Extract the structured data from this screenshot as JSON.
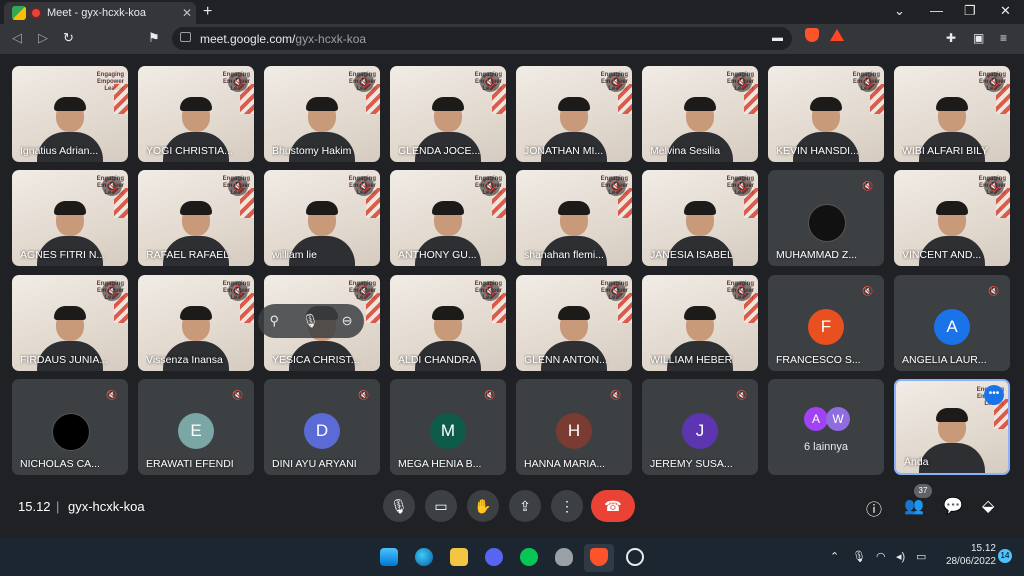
{
  "browser": {
    "tab_title": "Meet - gyx-hcxk-koa",
    "url_host": "meet.google.com/",
    "url_path": "gyx-hcxk-koa"
  },
  "participants": [
    {
      "name": "Ignatius Adrian...",
      "type": "video",
      "muted": false
    },
    {
      "name": "YOGI CHRISTIA...",
      "type": "video",
      "muted": true
    },
    {
      "name": "Bhustomy Hakim",
      "type": "video",
      "muted": true
    },
    {
      "name": "GLENDA JOCE...",
      "type": "video",
      "muted": true
    },
    {
      "name": "JONATHAN MI...",
      "type": "video",
      "muted": true
    },
    {
      "name": "Melvina Sesilia",
      "type": "video",
      "muted": true
    },
    {
      "name": "KEVIN HANSDI...",
      "type": "video",
      "muted": true
    },
    {
      "name": "WIBI ALFARI BILY",
      "type": "video",
      "muted": true
    },
    {
      "name": "AGNES FITRI N...",
      "type": "video",
      "muted": true
    },
    {
      "name": "RAFAEL RAFAEL",
      "type": "video",
      "muted": true
    },
    {
      "name": "william lie",
      "type": "video",
      "muted": true
    },
    {
      "name": "ANTHONY GU...",
      "type": "video",
      "muted": true
    },
    {
      "name": "shanahan flemi...",
      "type": "video",
      "muted": true
    },
    {
      "name": "JANESIA ISABEL",
      "type": "video",
      "muted": true
    },
    {
      "name": "MUHAMMAD Z...",
      "type": "avatar",
      "muted": true,
      "initial": "",
      "color": "#111111"
    },
    {
      "name": "VINCENT AND...",
      "type": "video",
      "muted": true
    },
    {
      "name": "FIRDAUS JUNIA...",
      "type": "video",
      "muted": true
    },
    {
      "name": "Vissenza Inansa",
      "type": "video",
      "muted": true
    },
    {
      "name": "YESICA CHRIST...",
      "type": "video",
      "muted": true
    },
    {
      "name": "ALDI CHANDRA",
      "type": "video",
      "muted": true
    },
    {
      "name": "GLENN ANTON...",
      "type": "video",
      "muted": true
    },
    {
      "name": "WILLIAM HEBER",
      "type": "video",
      "muted": true
    },
    {
      "name": "FRANCESCO S...",
      "type": "avatar",
      "muted": true,
      "initial": "F",
      "color": "#e8501f"
    },
    {
      "name": "ANGELIA LAUR...",
      "type": "avatar",
      "muted": true,
      "initial": "A",
      "color": "#1a73e8"
    },
    {
      "name": "NICHOLAS CA...",
      "type": "avatar",
      "muted": true,
      "initial": "",
      "color": "#000000"
    },
    {
      "name": "ERAWATI EFENDI",
      "type": "avatar",
      "muted": true,
      "initial": "E",
      "color": "#7aa6a6"
    },
    {
      "name": "DINI AYU ARYANI",
      "type": "avatar",
      "muted": true,
      "initial": "D",
      "color": "#5b6bd6"
    },
    {
      "name": "MEGA HENIA B...",
      "type": "avatar",
      "muted": true,
      "initial": "M",
      "color": "#0f5b4a"
    },
    {
      "name": "HANNA MARIA...",
      "type": "avatar",
      "muted": true,
      "initial": "H",
      "color": "#7a3b32"
    },
    {
      "name": "JEREMY SUSA...",
      "type": "avatar",
      "muted": true,
      "initial": "J",
      "color": "#5e35b1"
    }
  ],
  "others_tile": {
    "label": "6 lainnya",
    "initials": [
      "A",
      "W"
    ],
    "colors": [
      "#a142f4",
      "#8f6ce0"
    ]
  },
  "self_tile": {
    "name": "Anda"
  },
  "banner_text": "Engaging\nEmpower\nLeader",
  "meeting": {
    "time": "15.12",
    "separator": "|",
    "code": "gyx-hcxk-koa"
  },
  "people_count": "37",
  "taskbar": {
    "clock_time": "15.12",
    "clock_date": "28/06/2022",
    "notifications": "14"
  }
}
